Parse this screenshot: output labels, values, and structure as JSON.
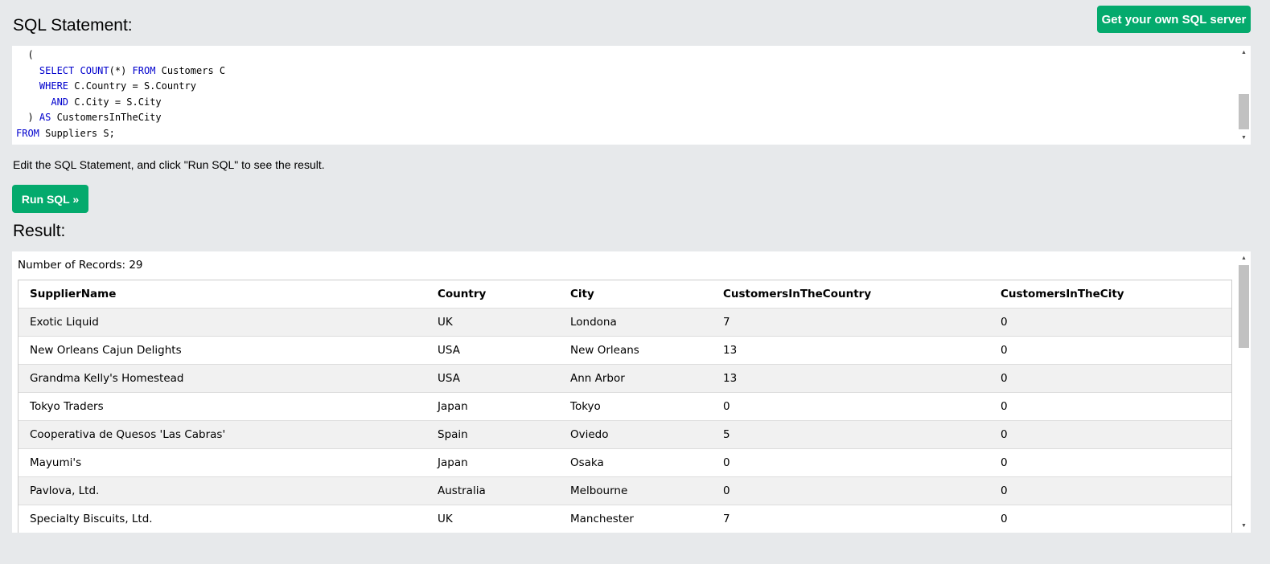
{
  "header": {
    "sql_heading": "SQL Statement:",
    "get_server_label": "Get your own SQL server"
  },
  "code": {
    "lines": [
      [
        {
          "t": "  ("
        }
      ],
      [
        {
          "t": "    "
        },
        {
          "t": "SELECT",
          "k": 1
        },
        {
          "t": " "
        },
        {
          "t": "COUNT",
          "k": 1
        },
        {
          "t": "(*) "
        },
        {
          "t": "FROM",
          "k": 1
        },
        {
          "t": " Customers C"
        }
      ],
      [
        {
          "t": "    "
        },
        {
          "t": "WHERE",
          "k": 1
        },
        {
          "t": " C.Country = S.Country"
        }
      ],
      [
        {
          "t": "      "
        },
        {
          "t": "AND",
          "k": 1
        },
        {
          "t": " C.City = S.City"
        }
      ],
      [
        {
          "t": "  ) "
        },
        {
          "t": "AS",
          "k": 1
        },
        {
          "t": " CustomersInTheCity"
        }
      ],
      [
        {
          "t": "FROM",
          "k": 1
        },
        {
          "t": " Suppliers S;"
        }
      ]
    ]
  },
  "hint": "Edit the SQL Statement, and click \"Run SQL\" to see the result.",
  "run_label": "Run SQL »",
  "result": {
    "heading": "Result:",
    "records": "Number of Records: 29",
    "columns": [
      "SupplierName",
      "Country",
      "City",
      "CustomersInTheCountry",
      "CustomersInTheCity"
    ],
    "rows": [
      [
        "Exotic Liquid",
        "UK",
        "Londona",
        "7",
        "0"
      ],
      [
        "New Orleans Cajun Delights",
        "USA",
        "New Orleans",
        "13",
        "0"
      ],
      [
        "Grandma Kelly's Homestead",
        "USA",
        "Ann Arbor",
        "13",
        "0"
      ],
      [
        "Tokyo Traders",
        "Japan",
        "Tokyo",
        "0",
        "0"
      ],
      [
        "Cooperativa de Quesos 'Las Cabras'",
        "Spain",
        "Oviedo",
        "5",
        "0"
      ],
      [
        "Mayumi's",
        "Japan",
        "Osaka",
        "0",
        "0"
      ],
      [
        "Pavlova, Ltd.",
        "Australia",
        "Melbourne",
        "0",
        "0"
      ],
      [
        "Specialty Biscuits, Ltd.",
        "UK",
        "Manchester",
        "7",
        "0"
      ]
    ]
  },
  "colors": {
    "accent": "#04aa6d",
    "keyword": "#0000cd",
    "background": "#e7e9eb"
  }
}
